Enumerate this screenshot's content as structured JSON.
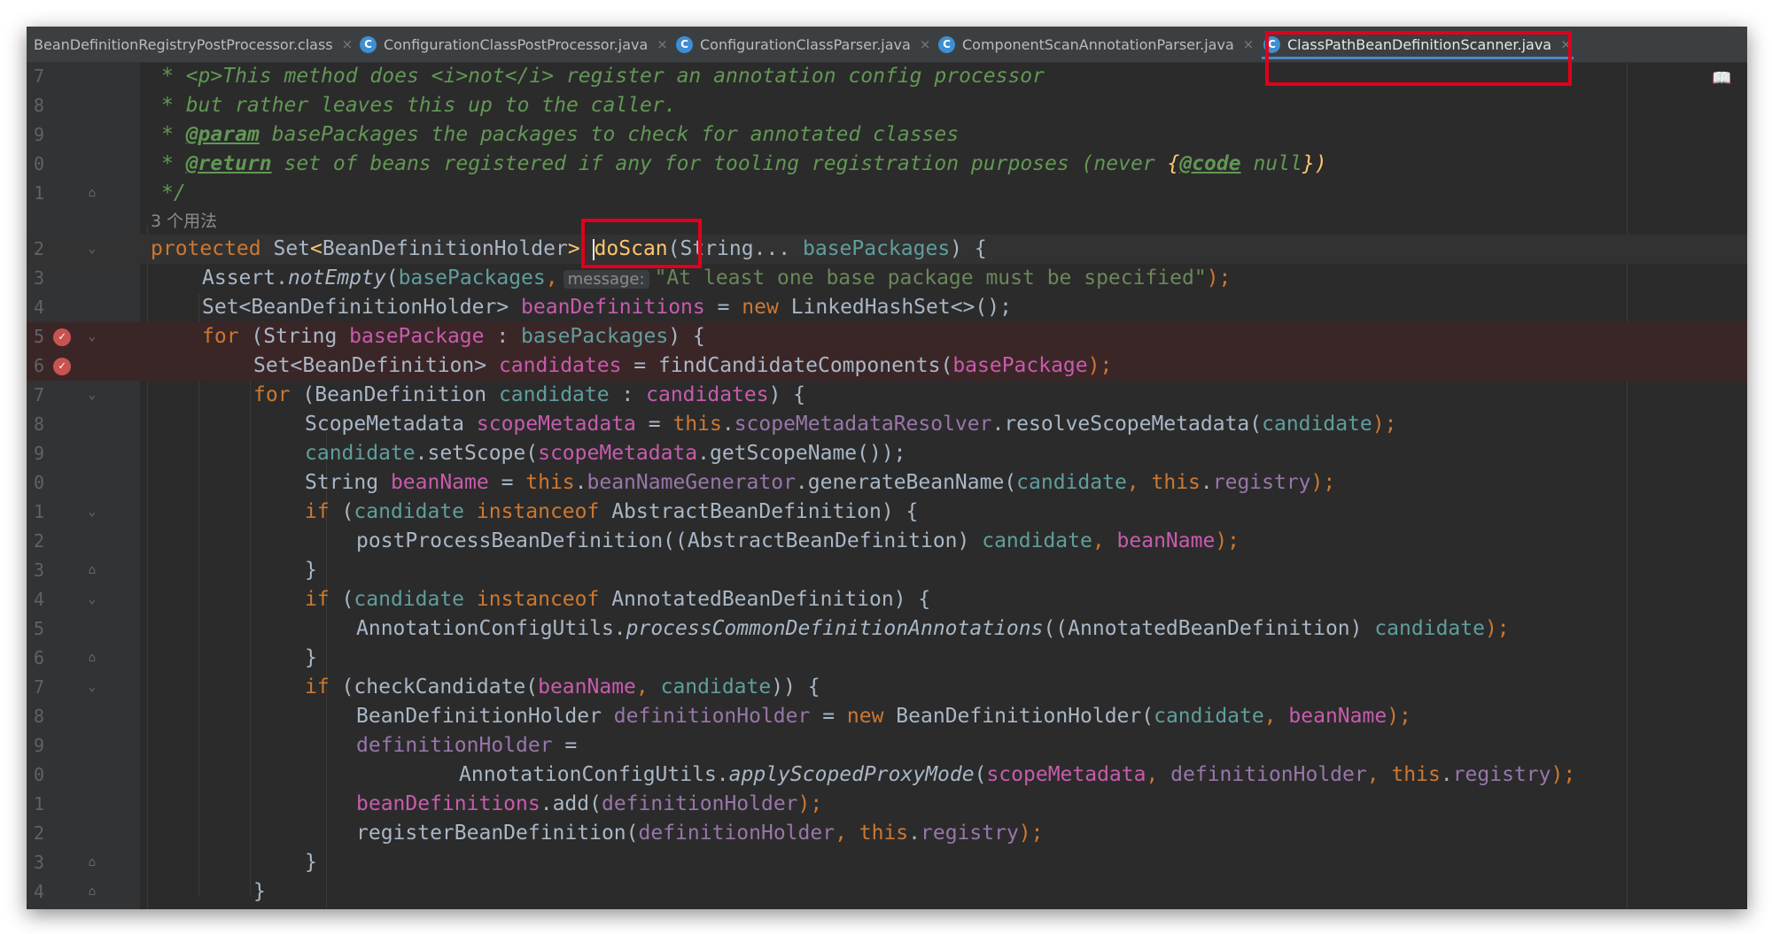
{
  "tabs": [
    {
      "label": "BeanDefinitionRegistryPostProcessor.class",
      "icon": "class-file-icon",
      "close": "×"
    },
    {
      "label": "ConfigurationClassPostProcessor.java",
      "icon": "java-class-icon",
      "close": "×"
    },
    {
      "label": "ConfigurationClassParser.java",
      "icon": "java-class-icon",
      "close": "×"
    },
    {
      "label": "ComponentScanAnnotationParser.java",
      "icon": "java-class-icon",
      "close": "×"
    },
    {
      "label": "ClassPathBeanDefinitionScanner.java",
      "icon": "java-class-icon",
      "close": "×",
      "active": true
    }
  ],
  "class_icon_glyph": "C",
  "reader_icon": "📖",
  "usages_hint": "3 个用法",
  "line_numbers": [
    "7",
    "8",
    "9",
    "0",
    "1",
    "2",
    "3",
    "4",
    "5",
    "6",
    "7",
    "8",
    "9",
    "0",
    "1",
    "2",
    "3",
    "4",
    "5",
    "6",
    "7",
    "8",
    "9",
    "0",
    "1",
    "2",
    "3",
    "4"
  ],
  "code": {
    "l7_a": "* <p>This method does <i>not</i> register an annotation config processor",
    "l8_a": "* but rather leaves this up to the caller.",
    "l9_star": "* ",
    "l9_tag": "@param",
    "l9_rest": " basePackages the packages to check for annotated classes",
    "l10_star": "* ",
    "l10_tag": "@return",
    "l10_rest": " set of beans registered if any for tooling registration purposes (never ",
    "l10_brace1": "{",
    "l10_code": "@code",
    "l10_null": " null",
    "l10_brace2": "})",
    "l11": "*/",
    "l12_protected": "protected ",
    "l12_set": "Set",
    "l12_lt": "<",
    "l12_type": "BeanDefinitionHolder",
    "l12_gt": ">",
    "l12_space": " ",
    "l12_name": "doScan",
    "l12_open": "(",
    "l12_args": "String... ",
    "l12_param": "basePackages",
    "l12_close": ") {",
    "l13_assert": "Assert.",
    "l13_notEmpty": "notEmpty",
    "l13_open": "(",
    "l13_arg": "basePackages",
    "l13_comma": ",",
    "l13_hint": "message:",
    "l13_str": "\"At least one base package must be specified\"",
    "l13_end": ");",
    "l14_a": "Set<BeanDefinitionHolder> ",
    "l14_var": "beanDefinitions",
    "l14_eq": " = ",
    "l14_new": "new",
    "l14_rest": " LinkedHashSet<>();",
    "l15_for": "for",
    "l15_a": " (String ",
    "l15_var": "basePackage",
    "l15_colon": " : ",
    "l15_arr": "basePackages",
    "l15_end": ") {",
    "l16_a": "Set<BeanDefinition> ",
    "l16_var": "candidates",
    "l16_eq": " = findCandidateComponents(",
    "l16_arg": "basePackage",
    "l16_end": ");",
    "l17_for": "for",
    "l17_a": " (BeanDefinition ",
    "l17_var": "candidate",
    "l17_colon": " : ",
    "l17_arr": "candidates",
    "l17_end": ") {",
    "l18_a": "ScopeMetadata ",
    "l18_var": "scopeMetadata",
    "l18_eq": " = ",
    "l18_this": "this",
    "l18_dot": ".",
    "l18_field": "scopeMetadataResolver",
    "l18_call": ".resolveScopeMetadata(",
    "l18_arg": "candidate",
    "l18_end": ");",
    "l19_var": "candidate",
    "l19_call": ".setScope(",
    "l19_arg": "scopeMetadata",
    "l19_call2": ".getScopeName());",
    "l20_a": "String ",
    "l20_var": "beanName",
    "l20_eq": " = ",
    "l20_this": "this",
    "l20_dot": ".",
    "l20_field": "beanNameGenerator",
    "l20_call": ".generateBeanName(",
    "l20_arg": "candidate",
    "l20_comma": ", ",
    "l20_this2": "this",
    "l20_dot2": ".",
    "l20_reg": "registry",
    "l20_end": ");",
    "l21_if": "if",
    "l21_open": " (",
    "l21_var": "candidate",
    "l21_inst": " instanceof ",
    "l21_type": "AbstractBeanDefinition",
    "l21_end": ") {",
    "l22_call": "postProcessBeanDefinition(",
    "l22_cast": "(AbstractBeanDefinition) ",
    "l22_arg": "candidate",
    "l22_comma": ", ",
    "l22_arg2": "beanName",
    "l22_end": ");",
    "l23": "}",
    "l24_if": "if",
    "l24_open": " (",
    "l24_var": "candidate",
    "l24_inst": " instanceof ",
    "l24_type": "AnnotatedBeanDefinition",
    "l24_end": ") {",
    "l25_cls": "AnnotationConfigUtils.",
    "l25_method": "processCommonDefinitionAnnotations",
    "l25_cast": "((AnnotatedBeanDefinition) ",
    "l25_arg": "candidate",
    "l25_end": ");",
    "l26": "}",
    "l27_if": "if",
    "l27_call": " (checkCandidate(",
    "l27_arg": "beanName",
    "l27_comma": ", ",
    "l27_arg2": "candidate",
    "l27_end": ")) {",
    "l28_a": "BeanDefinitionHolder ",
    "l28_var": "definitionHolder",
    "l28_eq": " = ",
    "l28_new": "new",
    "l28_call": " BeanDefinitionHolder(",
    "l28_arg": "candidate",
    "l28_comma": ", ",
    "l28_arg2": "beanName",
    "l28_end": ");",
    "l29_var": "definitionHolder",
    "l29_eq": " =",
    "l30_cls": "AnnotationConfigUtils.",
    "l30_method": "applyScopedProxyMode",
    "l30_open": "(",
    "l30_arg": "scopeMetadata",
    "l30_comma": ", ",
    "l30_arg2": "definitionHolder",
    "l30_comma2": ", ",
    "l30_this": "this",
    "l30_dot": ".",
    "l30_reg": "registry",
    "l30_end": ");",
    "l31_var": "beanDefinitions",
    "l31_call": ".add(",
    "l31_arg": "definitionHolder",
    "l31_end": ");",
    "l32_call": "registerBeanDefinition(",
    "l32_arg": "definitionHolder",
    "l32_comma": ", ",
    "l32_this": "this",
    "l32_dot": ".",
    "l32_reg": "registry",
    "l32_end": ");",
    "l33": "}",
    "l34": "}"
  },
  "colors": {
    "background": "#2b2b2b",
    "keyword": "#cc7832",
    "field": "#9876aa",
    "parameter": "#5f9e9c",
    "local_reassigned": "#c75cad",
    "string": "#6a8759",
    "doc_comment": "#629755",
    "method_declaration": "#ffc66d",
    "annotation_box": "#e0001a",
    "breakpoint": "#c75450"
  }
}
